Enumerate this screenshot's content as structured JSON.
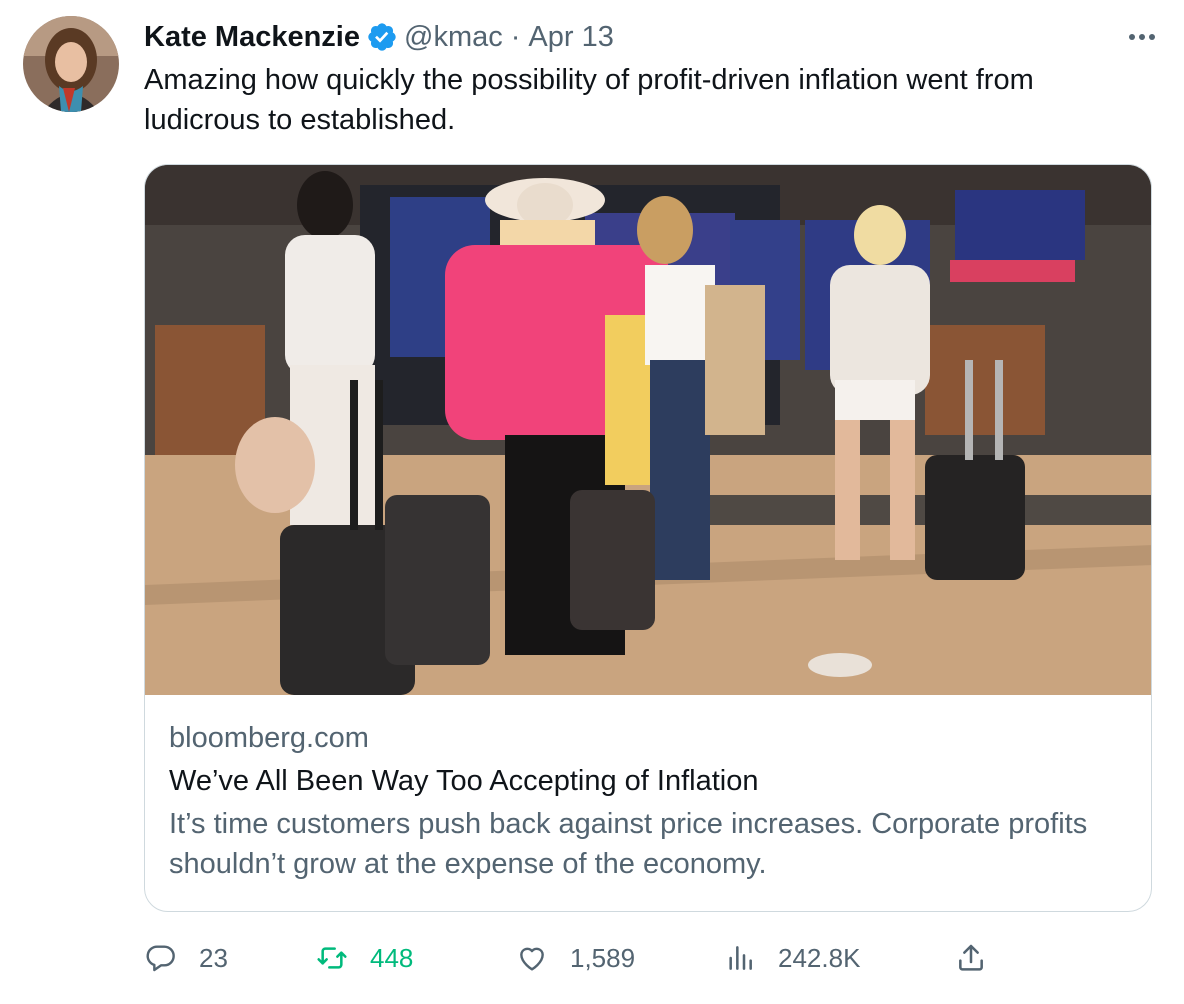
{
  "author": {
    "name": "Kate Mackenzie",
    "handle": "@kmac",
    "separator": "·",
    "date": "Apr 13"
  },
  "tweet": {
    "text": "Amazing how quickly the possibility of profit-driven inflation went from ludicrous to established."
  },
  "card": {
    "domain": "bloomberg.com",
    "headline": "We’ve All Been Way Too Accepting of Inflation",
    "description": "It’s time customers push back against price increases. Corporate profits shouldn’t grow at the expense of the economy."
  },
  "actions": {
    "replies": "23",
    "retweets": "448",
    "likes": "1,589",
    "views": "242.8K"
  },
  "colors": {
    "verified": "#1d9bf0",
    "retweet_active": "#00ba7c",
    "secondary_text": "#536471",
    "border": "#cfd9de"
  },
  "icons": [
    "verified-badge-icon",
    "more-icon",
    "reply-icon",
    "retweet-icon",
    "like-icon",
    "views-icon",
    "share-icon"
  ]
}
